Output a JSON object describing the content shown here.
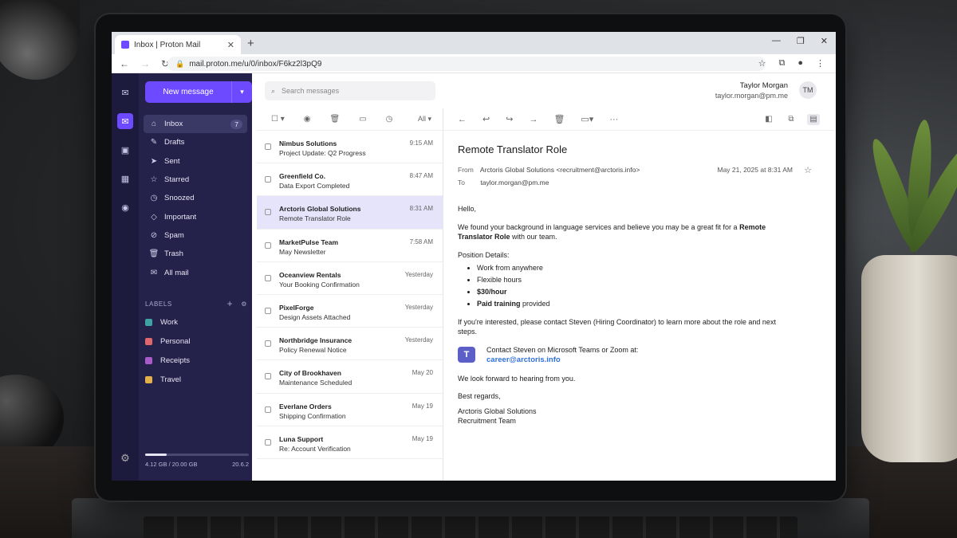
{
  "browser": {
    "tab_title": "Inbox | Proton Mail",
    "url": "mail.proton.me/u/0/inbox/F6kz2l3pQ9",
    "new_tab_symbol": "+",
    "close_symbol": "✕"
  },
  "sidebar": {
    "new_message_label": "New message",
    "folders": [
      {
        "label": "Inbox",
        "icon": "inbox-icon",
        "badge": "7",
        "active": true
      },
      {
        "label": "Drafts",
        "icon": "drafts-icon"
      },
      {
        "label": "Sent",
        "icon": "sent-icon"
      },
      {
        "label": "Starred",
        "icon": "star-icon"
      },
      {
        "label": "Snoozed",
        "icon": "clock-icon"
      },
      {
        "label": "Important",
        "icon": "important-icon"
      },
      {
        "label": "Spam",
        "icon": "spam-icon"
      },
      {
        "label": "Trash",
        "icon": "trash-icon"
      },
      {
        "label": "All mail",
        "icon": "all-mail-icon"
      }
    ],
    "labels_heading": "LABELS",
    "labels": [
      {
        "label": "Work",
        "color": "#3fa3a3"
      },
      {
        "label": "Personal",
        "color": "#e0676b"
      },
      {
        "label": "Receipts",
        "color": "#a85bc9"
      },
      {
        "label": "Travel",
        "color": "#e4b04a"
      }
    ],
    "storage": {
      "used_text": "4.12 GB / 20.00 GB",
      "version": "20.6.2",
      "used_fraction": 0.206
    }
  },
  "header": {
    "search_placeholder": "Search messages",
    "user_name": "Taylor Morgan",
    "user_email": "taylor.morgan@pm.me",
    "avatar_initials": "TM"
  },
  "list": {
    "filter_label": "All",
    "messages": [
      {
        "from": "Nimbus Solutions",
        "subject": "Project Update: Q2 Progress",
        "time": "9:15 AM"
      },
      {
        "from": "Greenfield Co.",
        "subject": "Data Export Completed",
        "time": "8:47 AM"
      },
      {
        "from": "Arctoris Global Solutions",
        "subject": "Remote Translator Role",
        "time": "8:31 AM",
        "selected": true
      },
      {
        "from": "MarketPulse Team",
        "subject": "May Newsletter",
        "time": "7:58 AM"
      },
      {
        "from": "Oceanview Rentals",
        "subject": "Your Booking Confirmation",
        "time": "Yesterday"
      },
      {
        "from": "PixelForge",
        "subject": "Design Assets Attached",
        "time": "Yesterday"
      },
      {
        "from": "Northbridge Insurance",
        "subject": "Policy Renewal Notice",
        "time": "Yesterday"
      },
      {
        "from": "City of Brookhaven",
        "subject": "Maintenance Scheduled",
        "time": "May 20"
      },
      {
        "from": "Everlane Orders",
        "subject": "Shipping Confirmation",
        "time": "May 19"
      },
      {
        "from": "Luna Support",
        "subject": "Re: Account Verification",
        "time": "May 19"
      }
    ]
  },
  "reader": {
    "subject": "Remote Translator Role",
    "from_label": "From",
    "from": "Arctoris Global Solutions <recruitment@arctoris.info>",
    "to_label": "To",
    "to": "taylor.morgan@pm.me",
    "date": "May 21, 2025 at 8:31 AM",
    "greeting": "Hello,",
    "intro_pre": "We found your background in language services and believe you may be a great fit for a",
    "intro_bold": "Remote Translator Role",
    "intro_post": " with our team.",
    "details_heading": "Position Details:",
    "detail_1": "Work from anywhere",
    "detail_2": "Flexible hours",
    "detail_3": "$30/hour",
    "detail_4_bold": "Paid training",
    "detail_4_rest": " provided",
    "contact_para": "If you're interested, please contact Steven (Hiring Coordinator) to learn more about the role and next steps.",
    "teams_text": "Contact Steven on Microsoft Teams or Zoom at:",
    "teams_email": "career@arctoris.info",
    "closing": "We look forward to hearing from you.",
    "regards": "Best regards,",
    "signature_1": "Arctoris Global Solutions",
    "signature_2": "Recruitment Team"
  }
}
